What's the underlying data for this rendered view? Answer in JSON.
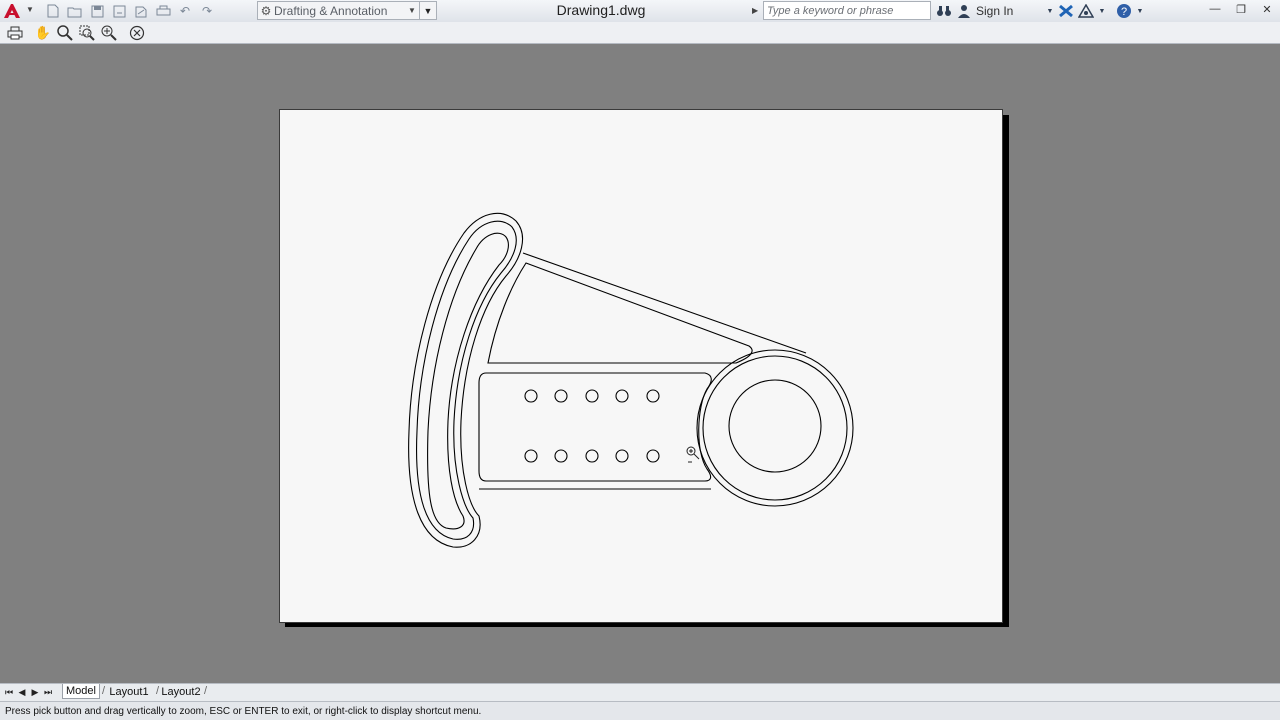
{
  "window": {
    "document_title": "Drawing1.dwg",
    "workspace": "Drafting & Annotation",
    "search_placeholder": "Type a keyword or phrase",
    "sign_in": "Sign In"
  },
  "quick_access": {
    "icons": [
      "new-icon",
      "open-icon",
      "save-icon",
      "save-as-icon",
      "plot-icon",
      "print-icon",
      "undo-icon",
      "redo-icon"
    ]
  },
  "toolbar": {
    "tools": [
      "print-icon",
      "pan-icon",
      "zoom-icon",
      "zoom-window-icon",
      "zoom-original-icon",
      "close-preview-icon"
    ]
  },
  "tabs": {
    "model": "Model",
    "layout1": "Layout1",
    "layout2": "Layout2"
  },
  "status": {
    "prompt": "Press pick button and drag vertically to zoom, ESC or ENTER to exit, or right-click to display shortcut menu."
  },
  "colors": {
    "background": "#808080",
    "paper": "#f7f7f7",
    "linework": "#000000",
    "app_logo_red": "#c8102e"
  }
}
